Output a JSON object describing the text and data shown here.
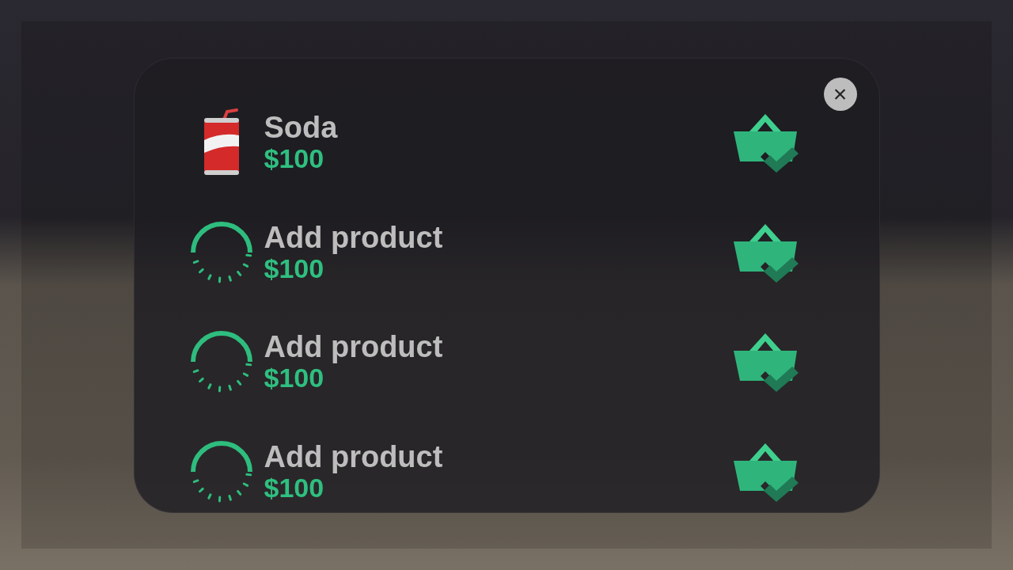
{
  "close_button": {
    "label": "×"
  },
  "items": [
    {
      "kind": "product",
      "name": "Soda",
      "price": "$100"
    },
    {
      "kind": "placeholder",
      "name": "Add product",
      "price": "$100"
    },
    {
      "kind": "placeholder",
      "name": "Add product",
      "price": "$100"
    },
    {
      "kind": "placeholder",
      "name": "Add product",
      "price": "$100"
    }
  ]
}
